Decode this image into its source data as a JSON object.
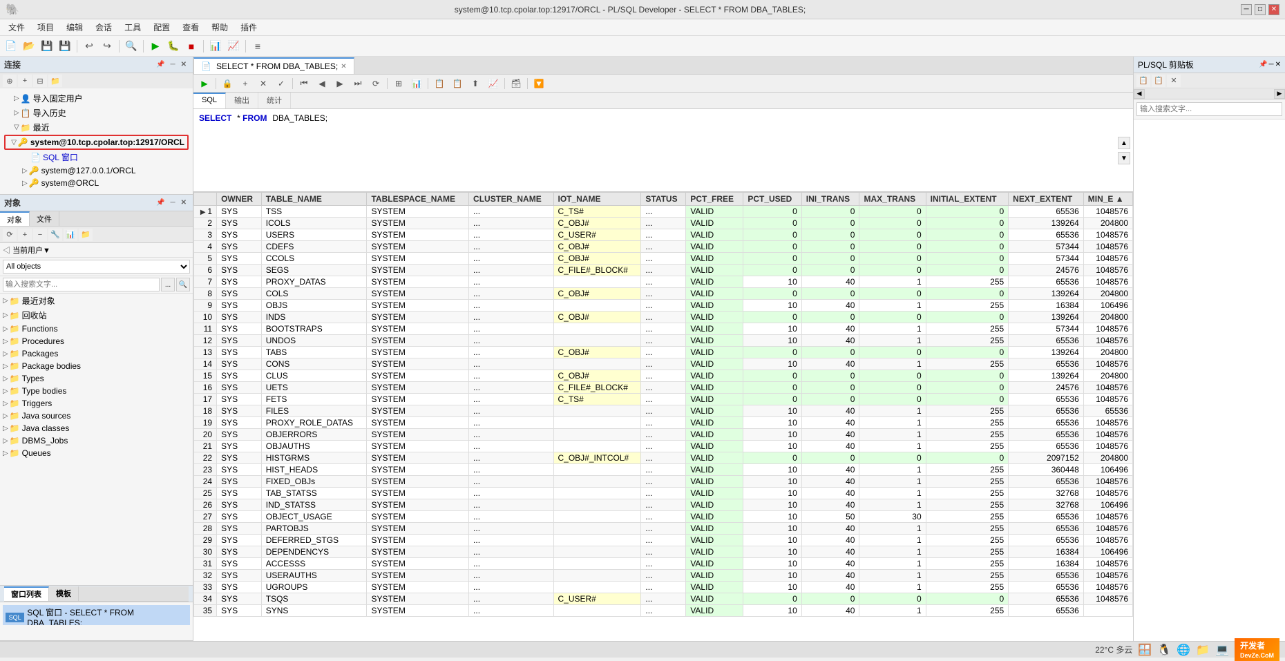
{
  "titleBar": {
    "title": "system@10.tcp.cpolar.top:12917/ORCL - PL/SQL Developer - SELECT * FROM DBA_TABLES;",
    "minBtn": "─",
    "maxBtn": "□",
    "closeBtn": "✕"
  },
  "menuBar": {
    "items": [
      "文件",
      "项目",
      "编辑",
      "会话",
      "工具",
      "配置",
      "查看",
      "帮助",
      "插件"
    ]
  },
  "connectionPanel": {
    "title": "连接",
    "treeItems": [
      {
        "label": "导入固定用户",
        "icon": "👤",
        "indent": 1
      },
      {
        "label": "导入历史",
        "icon": "📋",
        "indent": 1
      },
      {
        "label": "最近",
        "icon": "📁",
        "indent": 1,
        "expanded": true
      },
      {
        "label": "system@10.tcp.cpolar.top:12917/ORCL",
        "icon": "🔑",
        "indent": 2,
        "highlighted": true
      },
      {
        "label": "SQL 窗口",
        "icon": "📄",
        "indent": 3
      },
      {
        "label": "system@127.0.0.1/ORCL",
        "icon": "🔑",
        "indent": 2
      },
      {
        "label": "system@ORCL",
        "icon": "🔑",
        "indent": 2
      }
    ]
  },
  "objectsPanel": {
    "title": "对象",
    "tabs": [
      "对象",
      "文件"
    ],
    "activeTab": "对象",
    "filterLabel": "当前用户▼",
    "filterValue": "All objects",
    "searchPlaceholder": "输入搜索文字...",
    "treeItems": [
      {
        "label": "最近对象",
        "icon": "📁",
        "indent": 0
      },
      {
        "label": "回收站",
        "icon": "📁",
        "indent": 0
      },
      {
        "label": "Functions",
        "icon": "📁",
        "indent": 0
      },
      {
        "label": "Procedures",
        "icon": "📁",
        "indent": 0
      },
      {
        "label": "Packages",
        "icon": "📁",
        "indent": 0
      },
      {
        "label": "Package bodies",
        "icon": "📁",
        "indent": 0
      },
      {
        "label": "Types",
        "icon": "📁",
        "indent": 0
      },
      {
        "label": "Type bodies",
        "icon": "📁",
        "indent": 0
      },
      {
        "label": "Triggers",
        "icon": "📁",
        "indent": 0
      },
      {
        "label": "Java sources",
        "icon": "📁",
        "indent": 0
      },
      {
        "label": "Java classes",
        "icon": "📁",
        "indent": 0
      },
      {
        "label": "DBMS_Jobs",
        "icon": "📁",
        "indent": 0
      },
      {
        "label": "Queues",
        "icon": "📁",
        "indent": 0
      }
    ]
  },
  "windowListPanel": {
    "tabs": [
      "窗口列表",
      "模板"
    ],
    "activeTab": "窗口列表",
    "items": [
      {
        "label": "SQL 窗口 - SELECT * FROM DBA_TABLES;",
        "active": true
      }
    ]
  },
  "editorTabs": [
    {
      "label": "SELECT * FROM DBA_TABLES;",
      "active": true,
      "icon": "📄"
    }
  ],
  "innerTabs": [
    "SQL",
    "输出",
    "统计"
  ],
  "activeInnerTab": "SQL",
  "sqlContent": "SELECT * FROM DBA_TABLES;",
  "resultsTable": {
    "columns": [
      "",
      "OWNER",
      "TABLE_NAME",
      "TABLESPACE_NAME",
      "CLUSTER_NAME",
      "IOT_NAME",
      "STATUS",
      "PCT_FREE",
      "PCT_USED",
      "INI_TRANS",
      "MAX_TRANS",
      "INITIAL_EXTENT",
      "NEXT_EXTENT",
      "MIN_E ▲"
    ],
    "rows": [
      [
        1,
        "SYS",
        "TSS",
        "SYSTEM",
        "...",
        "C_TS#",
        "...",
        "VALID",
        0,
        0,
        0,
        0,
        65536,
        1048576
      ],
      [
        2,
        "SYS",
        "ICOLS",
        "SYSTEM",
        "...",
        "C_OBJ#",
        "...",
        "VALID",
        0,
        0,
        0,
        0,
        139264,
        204800
      ],
      [
        3,
        "SYS",
        "USERS",
        "SYSTEM",
        "...",
        "C_USER#",
        "...",
        "VALID",
        0,
        0,
        0,
        0,
        65536,
        1048576
      ],
      [
        4,
        "SYS",
        "CDEFS",
        "SYSTEM",
        "...",
        "C_OBJ#",
        "...",
        "VALID",
        0,
        0,
        0,
        0,
        57344,
        1048576
      ],
      [
        5,
        "SYS",
        "CCOLS",
        "SYSTEM",
        "...",
        "C_OBJ#",
        "...",
        "VALID",
        0,
        0,
        0,
        0,
        57344,
        1048576
      ],
      [
        6,
        "SYS",
        "SEGS",
        "SYSTEM",
        "...",
        "C_FILE#_BLOCK#",
        "...",
        "VALID",
        0,
        0,
        0,
        0,
        24576,
        1048576
      ],
      [
        7,
        "SYS",
        "PROXY_DATAS",
        "SYSTEM",
        "...",
        "",
        "...",
        "VALID",
        10,
        40,
        1,
        255,
        65536,
        1048576
      ],
      [
        8,
        "SYS",
        "COLS",
        "SYSTEM",
        "...",
        "C_OBJ#",
        "...",
        "VALID",
        0,
        0,
        0,
        0,
        139264,
        204800
      ],
      [
        9,
        "SYS",
        "OBJS",
        "SYSTEM",
        "...",
        "",
        "...",
        "VALID",
        10,
        40,
        1,
        255,
        16384,
        106496
      ],
      [
        10,
        "SYS",
        "INDS",
        "SYSTEM",
        "...",
        "C_OBJ#",
        "...",
        "VALID",
        0,
        0,
        0,
        0,
        139264,
        204800
      ],
      [
        11,
        "SYS",
        "BOOTSTRAPS",
        "SYSTEM",
        "...",
        "",
        "...",
        "VALID",
        10,
        40,
        1,
        255,
        57344,
        1048576
      ],
      [
        12,
        "SYS",
        "UNDOS",
        "SYSTEM",
        "...",
        "",
        "...",
        "VALID",
        10,
        40,
        1,
        255,
        65536,
        1048576
      ],
      [
        13,
        "SYS",
        "TABS",
        "SYSTEM",
        "...",
        "C_OBJ#",
        "...",
        "VALID",
        0,
        0,
        0,
        0,
        139264,
        204800
      ],
      [
        14,
        "SYS",
        "CONS",
        "SYSTEM",
        "...",
        "",
        "...",
        "VALID",
        10,
        40,
        1,
        255,
        65536,
        1048576
      ],
      [
        15,
        "SYS",
        "CLUS",
        "SYSTEM",
        "...",
        "C_OBJ#",
        "...",
        "VALID",
        0,
        0,
        0,
        0,
        139264,
        204800
      ],
      [
        16,
        "SYS",
        "UETS",
        "SYSTEM",
        "...",
        "C_FILE#_BLOCK#",
        "...",
        "VALID",
        0,
        0,
        0,
        0,
        24576,
        1048576
      ],
      [
        17,
        "SYS",
        "FETS",
        "SYSTEM",
        "...",
        "C_TS#",
        "...",
        "VALID",
        0,
        0,
        0,
        0,
        65536,
        1048576
      ],
      [
        18,
        "SYS",
        "FILES",
        "SYSTEM",
        "...",
        "",
        "...",
        "VALID",
        10,
        40,
        1,
        255,
        65536,
        65536
      ],
      [
        19,
        "SYS",
        "PROXY_ROLE_DATAS",
        "SYSTEM",
        "...",
        "",
        "...",
        "VALID",
        10,
        40,
        1,
        255,
        65536,
        1048576
      ],
      [
        20,
        "SYS",
        "OBJERRORS",
        "SYSTEM",
        "...",
        "",
        "...",
        "VALID",
        10,
        40,
        1,
        255,
        65536,
        1048576
      ],
      [
        21,
        "SYS",
        "OBJAUTHS",
        "SYSTEM",
        "...",
        "",
        "...",
        "VALID",
        10,
        40,
        1,
        255,
        65536,
        1048576
      ],
      [
        22,
        "SYS",
        "HISTGRMS",
        "SYSTEM",
        "...",
        "C_OBJ#_INTCOL#",
        "...",
        "VALID",
        0,
        0,
        0,
        0,
        2097152,
        204800
      ],
      [
        23,
        "SYS",
        "HIST_HEADS",
        "SYSTEM",
        "...",
        "",
        "...",
        "VALID",
        10,
        40,
        1,
        255,
        360448,
        106496
      ],
      [
        24,
        "SYS",
        "FIXED_OBJs",
        "SYSTEM",
        "...",
        "",
        "...",
        "VALID",
        10,
        40,
        1,
        255,
        65536,
        1048576
      ],
      [
        25,
        "SYS",
        "TAB_STATSS",
        "SYSTEM",
        "...",
        "",
        "...",
        "VALID",
        10,
        40,
        1,
        255,
        32768,
        1048576
      ],
      [
        26,
        "SYS",
        "IND_STATSS",
        "SYSTEM",
        "...",
        "",
        "...",
        "VALID",
        10,
        40,
        1,
        255,
        32768,
        106496
      ],
      [
        27,
        "SYS",
        "OBJECT_USAGE",
        "SYSTEM",
        "...",
        "",
        "...",
        "VALID",
        10,
        50,
        30,
        255,
        65536,
        1048576
      ],
      [
        28,
        "SYS",
        "PARTOBJS",
        "SYSTEM",
        "...",
        "",
        "...",
        "VALID",
        10,
        40,
        1,
        255,
        65536,
        1048576
      ],
      [
        29,
        "SYS",
        "DEFERRED_STGS",
        "SYSTEM",
        "...",
        "",
        "...",
        "VALID",
        10,
        40,
        1,
        255,
        65536,
        1048576
      ],
      [
        30,
        "SYS",
        "DEPENDENCYS",
        "SYSTEM",
        "...",
        "",
        "...",
        "VALID",
        10,
        40,
        1,
        255,
        16384,
        106496
      ],
      [
        31,
        "SYS",
        "ACCESSS",
        "SYSTEM",
        "...",
        "",
        "...",
        "VALID",
        10,
        40,
        1,
        255,
        16384,
        1048576
      ],
      [
        32,
        "SYS",
        "USERAUTHS",
        "SYSTEM",
        "...",
        "",
        "...",
        "VALID",
        10,
        40,
        1,
        255,
        65536,
        1048576
      ],
      [
        33,
        "SYS",
        "UGROUPS",
        "SYSTEM",
        "...",
        "",
        "...",
        "VALID",
        10,
        40,
        1,
        255,
        65536,
        1048576
      ],
      [
        34,
        "SYS",
        "TSQS",
        "SYSTEM",
        "...",
        "C_USER#",
        "...",
        "VALID",
        0,
        0,
        0,
        0,
        65536,
        1048576
      ],
      [
        35,
        "SYS",
        "SYNS",
        "SYSTEM",
        "...",
        "",
        "...",
        "VALID",
        10,
        40,
        1,
        255,
        65536,
        ""
      ]
    ]
  },
  "rightPanel": {
    "title": "PL/SQL 剪贴板",
    "searchPlaceholder": "输入搜索文字..."
  },
  "statusBar": {
    "temperature": "22°C",
    "weather": "多云",
    "devzeLabel": "开发者",
    "devzeSite": "DevZe.CoM"
  }
}
